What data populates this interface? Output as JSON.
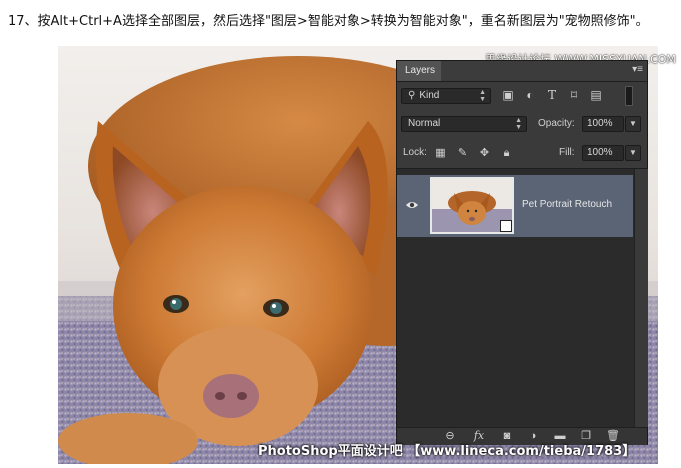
{
  "caption": "17、按Alt+Ctrl+A选择全部图层，然后选择\"图层>智能对象>转换为智能对象\"，重名新图层为\"宠物照修饰\"。",
  "watermarks": {
    "top": "思缘设计论坛 WWW.MISSYUAN.COM",
    "bottom": "PhotoShop平面设计吧 【www.lineca.com/tieba/1783】"
  },
  "layers_panel": {
    "tab_label": "Layers",
    "panel_menu_icon": "panel-menu-icon",
    "filter": {
      "kind_label": "Kind",
      "icons": [
        "image-filter-icon",
        "adjustment-filter-icon",
        "type-filter-icon",
        "shape-filter-icon",
        "smart-object-filter-icon"
      ]
    },
    "blend_mode": "Normal",
    "opacity_label": "Opacity:",
    "opacity_value": "100%",
    "lock_label": "Lock:",
    "fill_label": "Fill:",
    "fill_value": "100%",
    "layers": [
      {
        "name": "Pet Portrait Retouch",
        "visible": true,
        "selected": true,
        "smart_object": true
      }
    ],
    "bottom_icons": [
      "link-layers-icon",
      "fx-icon",
      "add-mask-icon",
      "new-fill-adjustment-icon",
      "new-group-icon",
      "new-layer-icon",
      "delete-layer-icon"
    ],
    "fx_label": "fx"
  },
  "colors": {
    "panel_bg": "#2b2b2b",
    "panel_row_bg": "#3a3a3a",
    "selected_layer": "#5a6475",
    "dog_fur": "#c56b25"
  }
}
